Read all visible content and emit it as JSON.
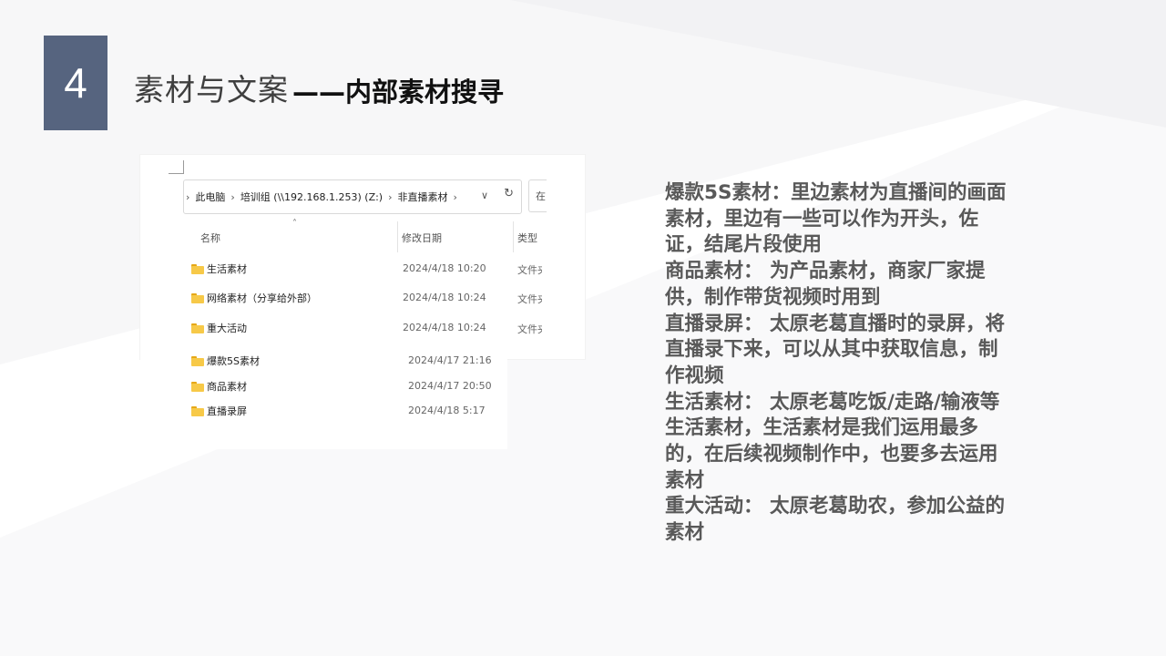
{
  "slide": {
    "number": "4",
    "title_main": "素材与文案",
    "title_sub": "——内部素材搜寻"
  },
  "explorer": {
    "breadcrumb": [
      "此电脑",
      "培训组 (\\\\192.168.1.253) (Z:)",
      "非直播素材"
    ],
    "search_char": "在",
    "columns": {
      "name": "名称",
      "modified": "修改日期",
      "type": "类型"
    },
    "rows": [
      {
        "name": "生活素材",
        "modified": "2024/4/18 10:20",
        "type": "文件夹"
      },
      {
        "name": "网络素材（分享给外部）",
        "modified": "2024/4/18 10:24",
        "type": "文件夹"
      },
      {
        "name": "重大活动",
        "modified": "2024/4/18 10:24",
        "type": "文件夹"
      },
      {
        "name": "爆款5S素材",
        "modified": "2024/4/17 21:16"
      },
      {
        "name": "商品素材",
        "modified": "2024/4/17 20:50"
      },
      {
        "name": "直播录屏",
        "modified": "2024/4/18 5:17"
      }
    ]
  },
  "description": [
    "爆款5S素材：里边素材为直播间的画面素材，里边有一些可以作为开头，佐证，结尾片段使用",
    "商品素材： 为产品素材，商家厂家提供，制作带货视频时用到",
    "直播录屏： 太原老葛直播时的录屏，将直播录下来，可以从其中获取信息，制作视频",
    "生活素材： 太原老葛吃饭/走路/输液等生活素材，生活素材是我们运用最多的，在后续视频制作中，也要多去运用素材",
    "重大活动： 太原老葛助农，参加公益的素材"
  ],
  "colors": {
    "accent": "#56647f",
    "text": "#595959",
    "folder": "#f7c948"
  }
}
